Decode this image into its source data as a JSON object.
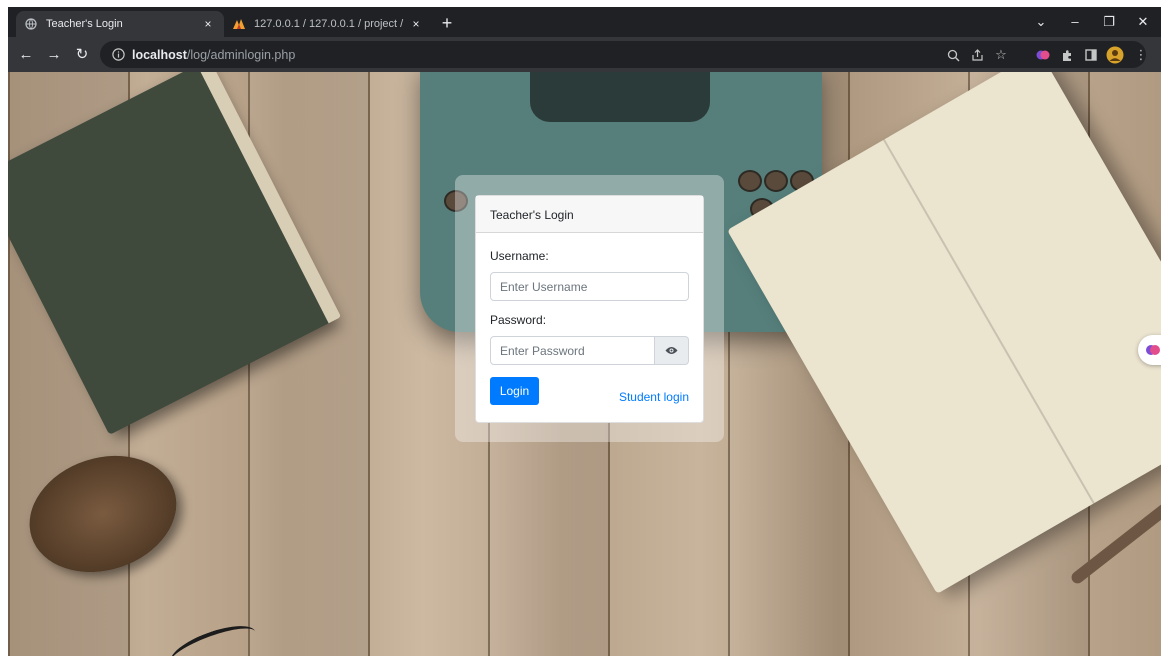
{
  "browser": {
    "tabs": [
      {
        "title": "Teacher's Login",
        "active": true,
        "close": "×"
      },
      {
        "title": "127.0.0.1 / 127.0.0.1 / project / ",
        "active": false,
        "close": "×"
      }
    ],
    "new_tab": "+",
    "window_controls": {
      "minimize": "–",
      "maximize": "❐",
      "close": "✕"
    },
    "url": {
      "host": "localhost",
      "path": "/log/adminlogin.php"
    }
  },
  "login": {
    "header": "Teacher's Login",
    "username_label": "Username:",
    "username_placeholder": "Enter Username",
    "password_label": "Password:",
    "password_placeholder": "Enter Password",
    "login_button": "Login",
    "student_link": "Student login"
  },
  "colors": {
    "primary": "#007bff",
    "chrome_dark": "#202124",
    "chrome_toolbar": "#35363a"
  }
}
